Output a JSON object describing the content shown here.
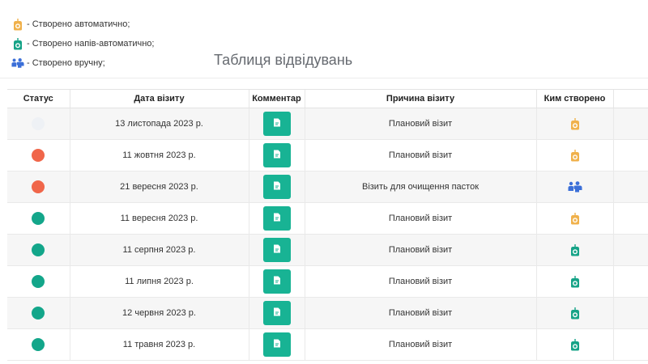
{
  "colors": {
    "auto": "#f0b14b",
    "semi_auto": "#16a387",
    "manual": "#3b6fd8",
    "status_red": "#f0664a",
    "status_green": "#13a68a",
    "status_empty": "#eef1f5",
    "accent_button": "#18b394"
  },
  "legend": [
    {
      "icon": "robot-orange-icon",
      "type": "auto",
      "label": "- Створено автоматично;"
    },
    {
      "icon": "robot-green-icon",
      "type": "semi_auto",
      "label": "- Створено напів-автоматично;"
    },
    {
      "icon": "people-blue-icon",
      "type": "manual",
      "label": "- Створено вручну;"
    }
  ],
  "page": {
    "title": "Таблиця відвідувань"
  },
  "table": {
    "headers": [
      "Статус",
      "Дата візиту",
      "Комментар",
      "Причина візиту",
      "Ким створено",
      ""
    ],
    "rows": [
      {
        "status": "empty",
        "date": "13 листопада 2023 р.",
        "reason": "Плановий візит",
        "creator": "auto"
      },
      {
        "status": "red",
        "date": "11 жовтня 2023 р.",
        "reason": "Плановий візит",
        "creator": "auto"
      },
      {
        "status": "red",
        "date": "21 вересня 2023 р.",
        "reason": "Візить для очищення пасток",
        "creator": "manual"
      },
      {
        "status": "green",
        "date": "11 вересня 2023 р.",
        "reason": "Плановий візит",
        "creator": "auto"
      },
      {
        "status": "green",
        "date": "11 серпня 2023 р.",
        "reason": "Плановий візит",
        "creator": "semi_auto"
      },
      {
        "status": "green",
        "date": "11 липня 2023 р.",
        "reason": "Плановий візит",
        "creator": "semi_auto"
      },
      {
        "status": "green",
        "date": "12 червня 2023 р.",
        "reason": "Плановий візит",
        "creator": "semi_auto"
      },
      {
        "status": "green",
        "date": "11 травня 2023 р.",
        "reason": "Плановий візит",
        "creator": "semi_auto"
      }
    ]
  }
}
